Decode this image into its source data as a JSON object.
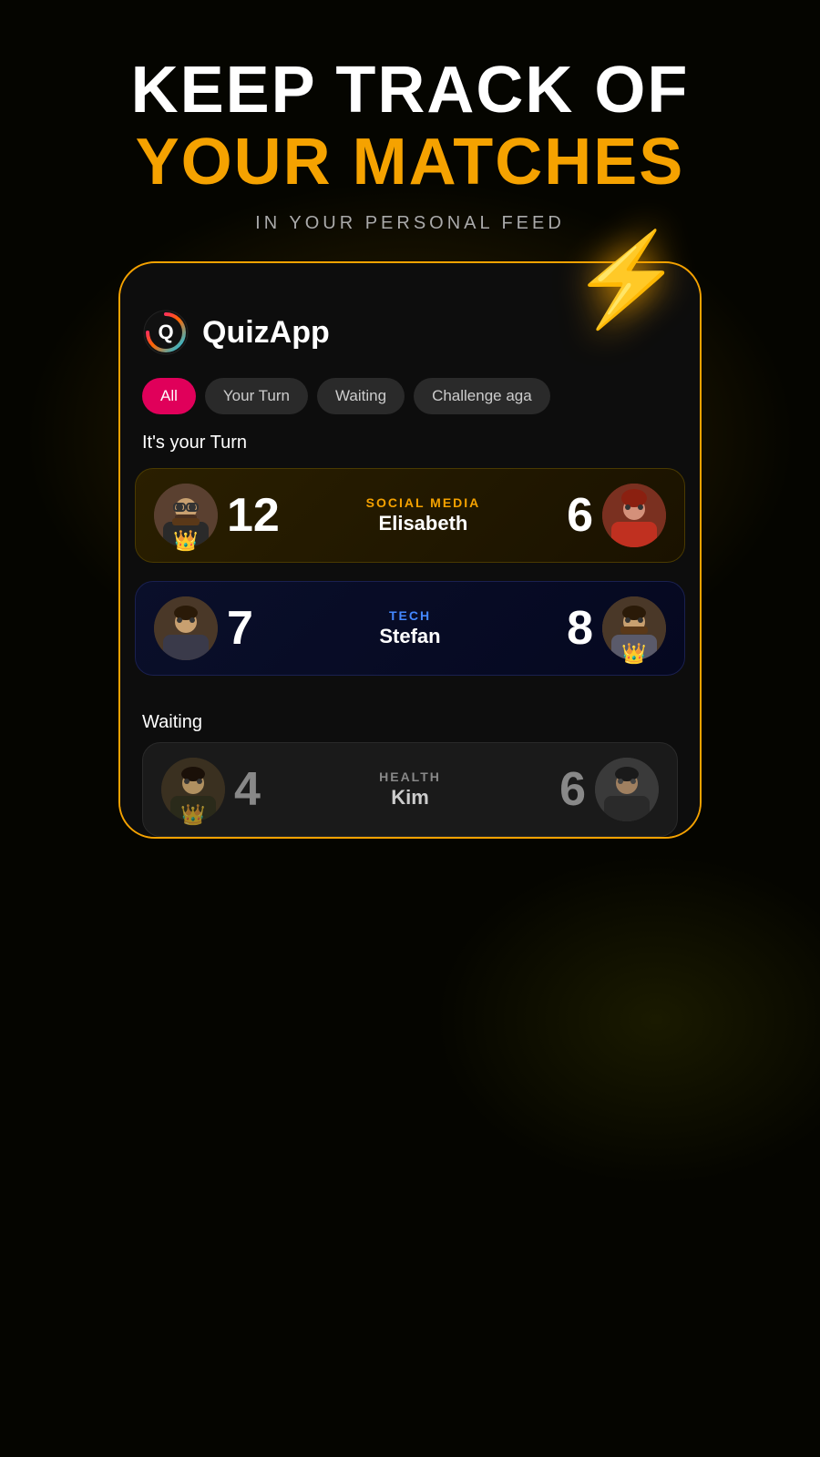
{
  "header": {
    "line1": "KEEP TRACK OF",
    "line2": "YOUR MATCHES",
    "subtitle": "IN YOUR PERSONAL FEED"
  },
  "app": {
    "name": "QuizApp"
  },
  "tabs": [
    {
      "label": "All",
      "active": true
    },
    {
      "label": "Your Turn",
      "active": false
    },
    {
      "label": "Waiting",
      "active": false
    },
    {
      "label": "Challenge aga",
      "active": false
    }
  ],
  "section_your_turn": "It's your Turn",
  "section_waiting": "Waiting",
  "matches": [
    {
      "type": "your_turn",
      "category": "SOCIAL MEDIA",
      "opponent_name": "Elisabeth",
      "score_left": "12",
      "score_right": "6",
      "player_has_crown": true,
      "opponent_has_crown": false
    },
    {
      "type": "your_turn",
      "category": "TECH",
      "opponent_name": "Stefan",
      "score_left": "7",
      "score_right": "8",
      "player_has_crown": false,
      "opponent_has_crown": true
    }
  ],
  "waiting_match": {
    "category": "HEALTH",
    "opponent_name": "Kim",
    "score_left": "4",
    "score_right": "6"
  },
  "lightning": "⚡"
}
